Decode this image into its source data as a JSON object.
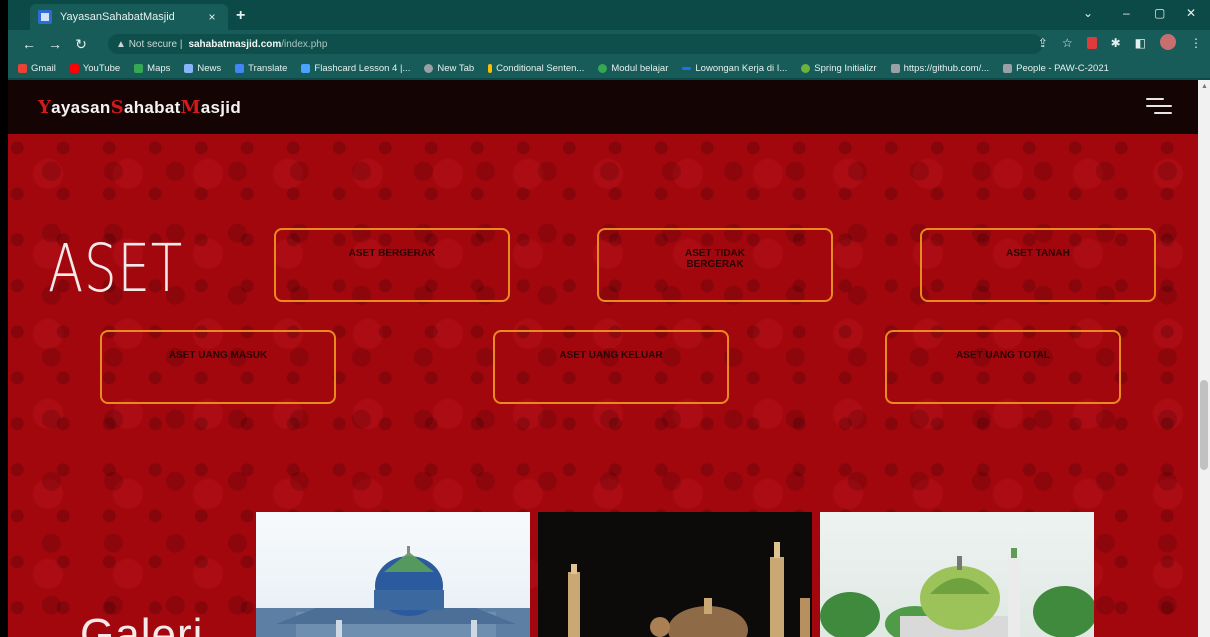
{
  "browser": {
    "tab_title": "YayasanSahabatMasjid",
    "tab_close": "×",
    "new_tab": "+",
    "url_security": "Not secure",
    "url_host": "sahabatmasjid.com",
    "url_path": "/index.php",
    "window_controls": [
      "⌄",
      "–",
      "▢",
      "✕"
    ],
    "bookmarks": [
      "Gmail",
      "YouTube",
      "Maps",
      "News",
      "Translate",
      "Flashcard Lesson 4 |...",
      "New Tab",
      "Conditional Senten...",
      "Modul belajar",
      "Lowongan Kerja di I...",
      "Spring Initializr",
      "https://github.com/...",
      "People - PAW-C-2021"
    ]
  },
  "site": {
    "brand": {
      "c1": "Y",
      "t1": "ayasan",
      "c2": "S",
      "t2": "ahabat",
      "c3": "M",
      "t3": "asjid"
    },
    "section_title": "ASET",
    "cards": [
      {
        "label": "ASET BERGERAK"
      },
      {
        "label": "ASET TIDAK BERGERAK"
      },
      {
        "label": "ASET TANAH"
      },
      {
        "label": "ASET UANG MASUK"
      },
      {
        "label": "ASET UANG KELUAR"
      },
      {
        "label": "ASET UANG TOTAL"
      }
    ],
    "gallery_title": "Galeri"
  },
  "colors": {
    "page_bg": "#a3070e",
    "navbar_bg": "#140404",
    "card_border": "#e88a1f",
    "brand_accent": "#d11a1a",
    "browser_frame": "#0c4a47"
  }
}
